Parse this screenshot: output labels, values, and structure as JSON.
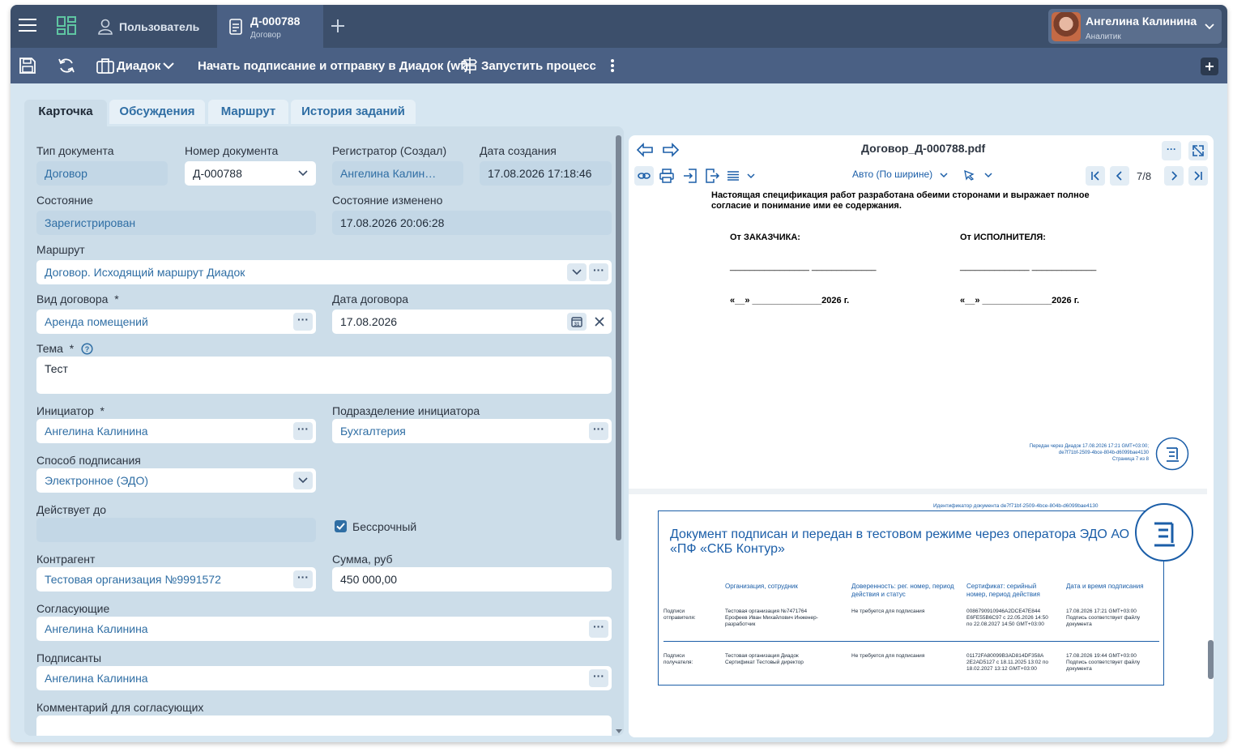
{
  "topbar": {
    "user_tab_label": "Пользователь",
    "doc_tab_title": "Д-000788",
    "doc_tab_subtitle": "Договор",
    "user_name": "Ангелина Калинина",
    "user_role": "Аналитик"
  },
  "toolbar": {
    "diadoc_label": "Диадок",
    "start_sign_label": "Начать подписание и отправку в Диадок (wf)",
    "run_process_label": "Запустить процесс"
  },
  "tabs": [
    "Карточка",
    "Обсуждения",
    "Маршрут",
    "История заданий"
  ],
  "form": {
    "doc_type_label": "Тип документа",
    "doc_type": "Договор",
    "doc_number_label": "Номер документа",
    "doc_number": "Д-000788",
    "registrar_label": "Регистратор (Создал)",
    "registrar": "Ангелина Калин…",
    "created_label": "Дата создания",
    "created": "17.08.2026 17:18:46",
    "state_label": "Состояние",
    "state": "Зарегистрирован",
    "state_changed_label": "Состояние изменено",
    "state_changed": "17.08.2026 20:06:28",
    "route_label": "Маршрут",
    "route": "Договор. Исходящий маршрут Диадок",
    "contract_kind_label": "Вид договора",
    "contract_kind": "Аренда помещений",
    "contract_date_label": "Дата договора",
    "contract_date": "17.08.2026",
    "subject_label": "Тема",
    "subject": "Тест",
    "initiator_label": "Инициатор",
    "initiator": "Ангелина Калинина",
    "department_label": "Подразделение инициатора",
    "department": "Бухгалтерия",
    "sign_method_label": "Способ подписания",
    "sign_method": "Электронное (ЭДО)",
    "valid_until_label": "Действует до",
    "perpetual_label": "Бессрочный",
    "counterparty_label": "Контрагент",
    "counterparty": "Тестовая организация №9991572",
    "amount_label": "Сумма, руб",
    "amount": "450 000,00",
    "approvers_label": "Согласующие",
    "approvers": "Ангелина Калинина",
    "signers_label": "Подписанты",
    "signers": "Ангелина Калинина",
    "comment_label": "Комментарий для согласующих",
    "required_mark": "*"
  },
  "viewer": {
    "filename": "Договор_Д-000788.pdf",
    "zoom": "Авто (По ширине)",
    "page_indicator": "7/8",
    "page7": {
      "spec_text_1": "Настоящая спецификация работ разработана обеими сторонами и выражает полное",
      "spec_text_2": "согласие и понимание ими ее содержания.",
      "from_customer": "От ЗАКАЗЧИКА:",
      "from_contractor": "От ИСПОЛНИТЕЛЯ:",
      "sign_line": "________________ _____________",
      "sign_line_2": "______________ _____________",
      "date_line": "«__» ______________2026 г.",
      "stamp_1": "Передан через Диадок 17.08.2026 17:21 GMT+03:00;",
      "stamp_2": "de7f71bf-2509-4bce-804b-d6099bae4130",
      "stamp_3": "Страница 7 из 8"
    },
    "page8": {
      "doc_id": "Идентификатор документа de7f71bf-2509-4bce-804b-d6099bae4130",
      "heading": "Документ подписан и передан в тестовом режиме через оператора ЭДО АО «ПФ «СКБ Контур»",
      "col_org": "Организация, сотрудник",
      "col_poa": "Доверенность: рег. номер, период действия и статус",
      "col_cert": "Сертификат: серийный номер, период действия",
      "col_date": "Дата и время подписания",
      "row1": {
        "label": "Подписи отправителя:",
        "org": "Тестовая организация №7471764 Ерофеев Иван Михайлович Инженер-разработчик",
        "poa": "Не требуется для подписания",
        "cert": "0086790910946A2DCE47E844 E6FE55B6C97 с 22.05.2026 14:50 по 22.08.2027 14:50 GMT+03:00",
        "date": "17.08.2026 17:21 GMT+03:00 Подпись соответствует файлу документа"
      },
      "row2": {
        "label": "Подписи получателя:",
        "org": "Тестовая организация Диадок Сертификат Тестовый директор",
        "poa": "Не требуется для подписания",
        "cert": "01172FA80099B3AD814DF358A 2E2AD5127 с 18.11.2025 13:02 по 18.02.2027 13:12 GMT+03:00",
        "date": "17.08.2026 19:44 GMT+03:00 Подпись соответствует файлу документа"
      }
    }
  },
  "colors": {
    "topbar": "#3c4f6b",
    "toolbar": "#4a6084",
    "link": "#2f6ea4",
    "accent": "#1b5ea8"
  }
}
